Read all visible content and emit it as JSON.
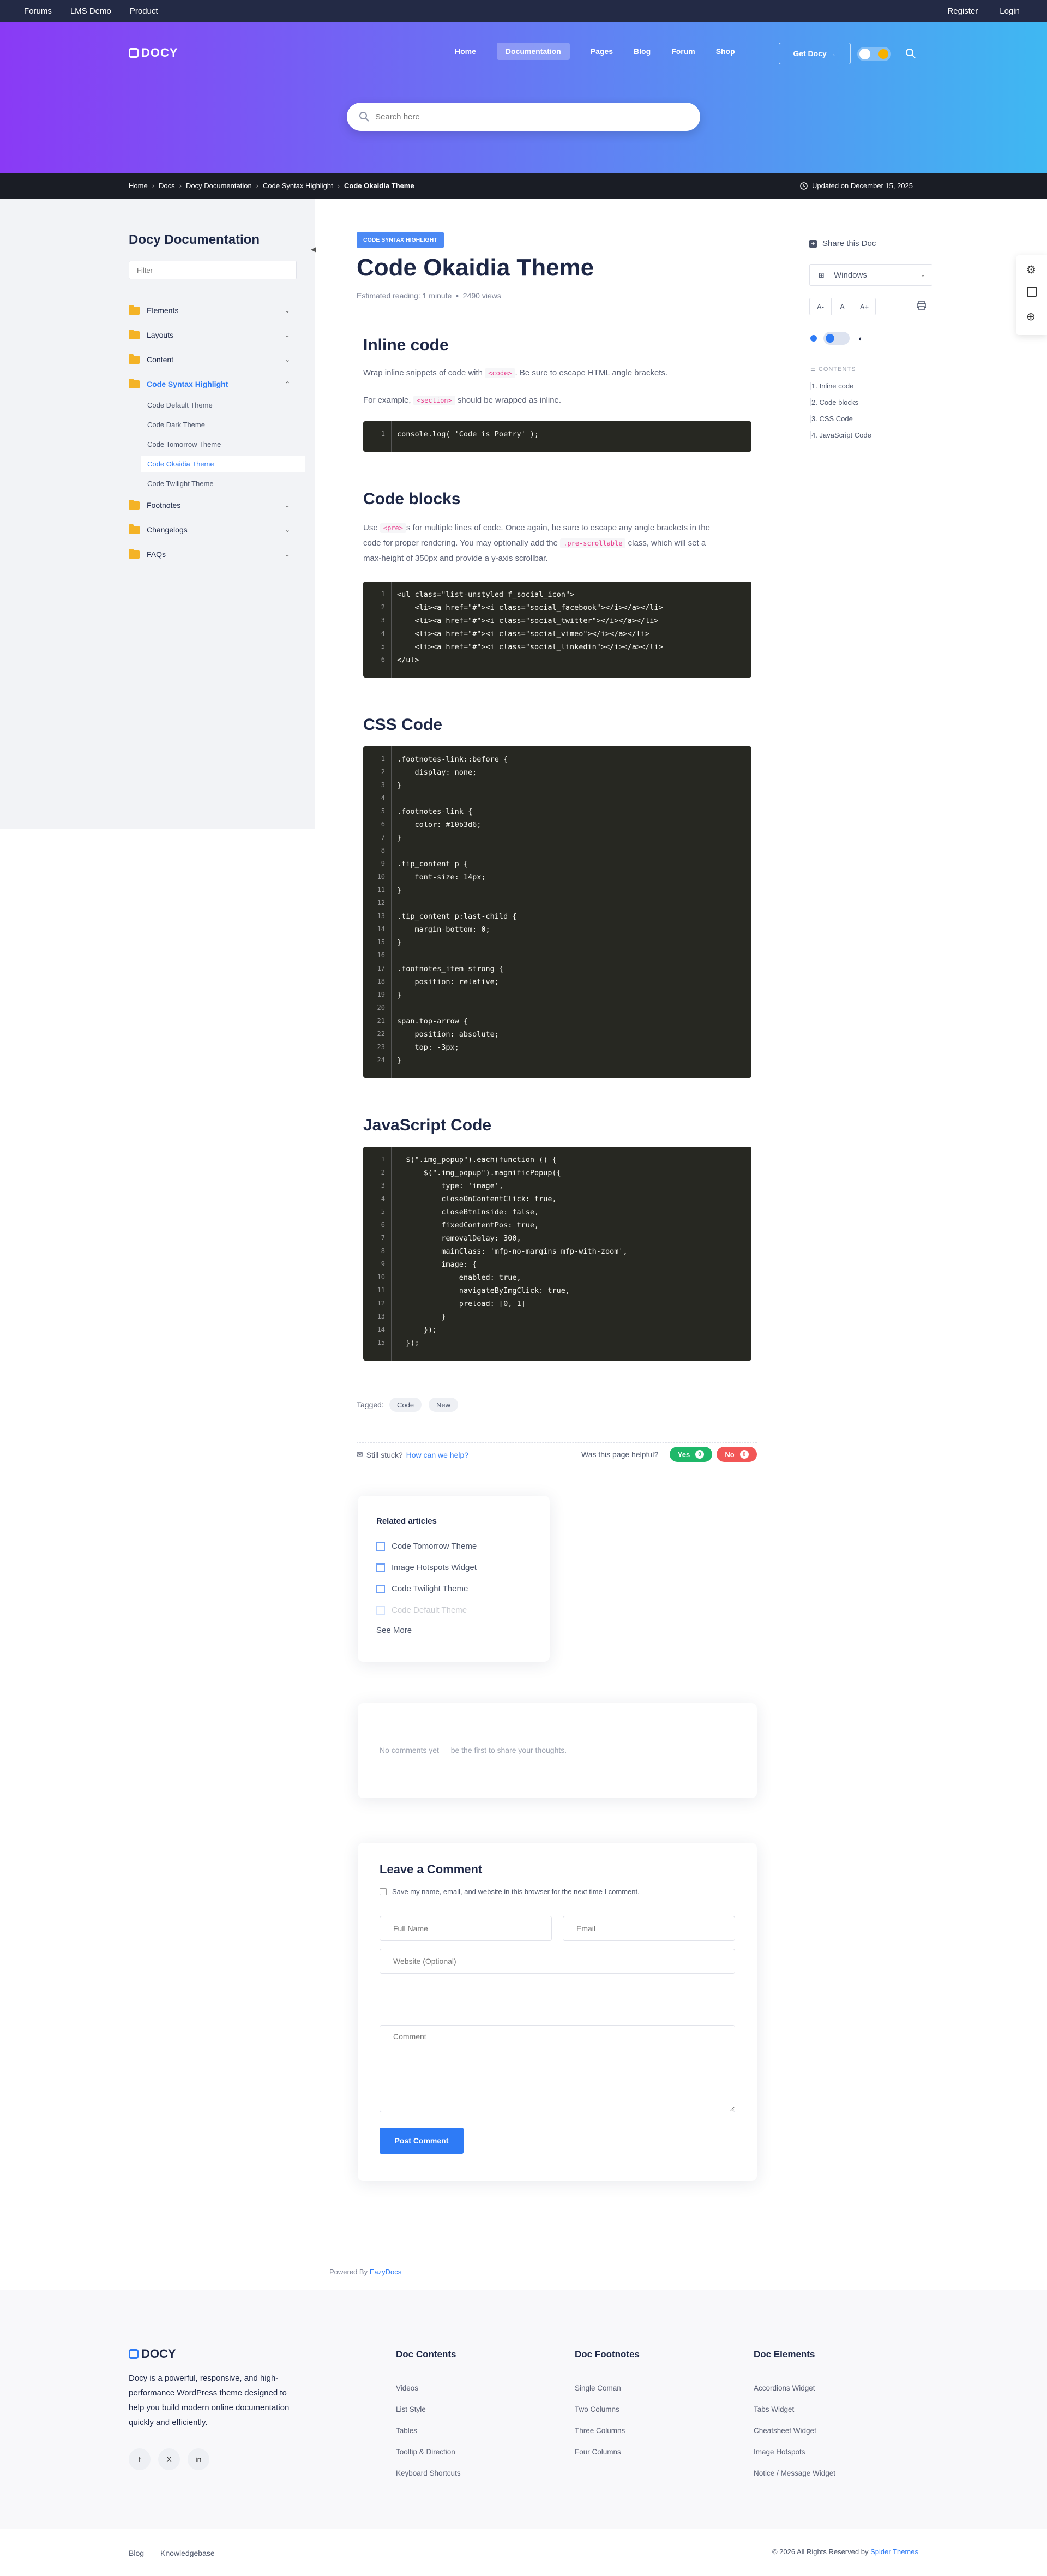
{
  "topbar": {
    "left": [
      "Forums",
      "LMS Demo",
      "Product"
    ],
    "right": [
      "Register",
      "Login"
    ]
  },
  "brand": "DOCY",
  "nav": {
    "items": [
      "Home",
      "Documentation",
      "Pages",
      "Blog",
      "Forum",
      "Shop"
    ],
    "active": "Documentation",
    "cta": "Get Docy →"
  },
  "search": {
    "placeholder": "Search here"
  },
  "breadcrumb": {
    "items": [
      "Home",
      "Docs",
      "Docy Documentation",
      "Code Syntax Highlight",
      "Code Okaidia Theme"
    ],
    "updated": "Updated on December 15, 2025"
  },
  "sidebar": {
    "title": "Docy Documentation",
    "filter_placeholder": "Filter",
    "items": [
      {
        "label": "Elements",
        "chevron": "⌄"
      },
      {
        "label": "Layouts",
        "chevron": "⌄"
      },
      {
        "label": "Content",
        "chevron": "⌄"
      },
      {
        "label": "Code Syntax Highlight",
        "chevron": "⌃"
      },
      {
        "label": "Footnotes",
        "chevron": "⌄"
      },
      {
        "label": "Changelogs",
        "chevron": "⌄"
      },
      {
        "label": "FAQs",
        "chevron": "⌄"
      }
    ],
    "subitems": [
      "Code Default Theme",
      "Code Dark Theme",
      "Code Tomorrow Theme",
      "Code Okaidia Theme",
      "Code Twilight Theme"
    ],
    "current": "Code Okaidia Theme"
  },
  "doc": {
    "badge": "CODE SYNTAX HIGHLIGHT",
    "title": "Code Okaidia Theme",
    "reading": "Estimated reading: 1 minute",
    "views": "2490 views"
  },
  "sections": {
    "inline": {
      "title": "Inline code",
      "p1_a": "Wrap inline snippets of code with",
      "p1_code": "<code>",
      "p1_b": ". Be sure to escape HTML angle brackets.",
      "p2_a": "For example,",
      "p2_code": "<section>",
      "p2_b": "should be wrapped as inline.",
      "code": [
        "console.log( 'Code is Poetry' );"
      ]
    },
    "blocks": {
      "title": "Code blocks",
      "p_a": "Use",
      "p_code1": "<pre>",
      "p_b": "s for multiple lines of code. Once again, be sure to escape any angle brackets in the",
      "p_c": "code for proper rendering. You may optionally add the",
      "p_code2": ".pre-scrollable",
      "p_d": "class, which will set a",
      "p_e": "max-height of 350px and provide a y-axis scrollbar.",
      "code": [
        "<ul class=\"list-unstyled f_social_icon\">",
        "    <li><a href=\"#\"><i class=\"social_facebook\"></i></a></li>",
        "    <li><a href=\"#\"><i class=\"social_twitter\"></i></a></li>",
        "    <li><a href=\"#\"><i class=\"social_vimeo\"></i></a></li>",
        "    <li><a href=\"#\"><i class=\"social_linkedin\"></i></a></li>",
        "</ul>"
      ]
    },
    "css": {
      "title": "CSS Code",
      "code": [
        ".footnotes-link::before {",
        "    display: none;",
        "}",
        "",
        ".footnotes-link {",
        "    color: #10b3d6;",
        "}",
        "",
        ".tip_content p {",
        "    font-size: 14px;",
        "}",
        "",
        ".tip_content p:last-child {",
        "    margin-bottom: 0;",
        "}",
        "",
        ".footnotes_item strong {",
        "    position: relative;",
        "}",
        "",
        "span.top-arrow {",
        "    position: absolute;",
        "    top: -3px;",
        "}"
      ]
    },
    "js": {
      "title": "JavaScript Code",
      "code": [
        "  $(\".img_popup\").each(function () {",
        "      $(\".img_popup\").magnificPopup({",
        "          type: 'image',",
        "          closeOnContentClick: true,",
        "          closeBtnInside: false,",
        "          fixedContentPos: true,",
        "          removalDelay: 300,",
        "          mainClass: 'mfp-no-margins mfp-with-zoom',",
        "          image: {",
        "              enabled: true,",
        "              navigateByImgClick: true,",
        "              preload: [0, 1]",
        "          }",
        "      });",
        "  });"
      ]
    }
  },
  "tags": {
    "label": "Tagged:",
    "items": [
      "Code",
      "New"
    ]
  },
  "help": {
    "stuck": "Still stuck?",
    "link": "How can we help?",
    "helpful": "Was this page helpful?",
    "yes": "Yes",
    "yes_count": "0",
    "no": "No",
    "no_count": "0"
  },
  "related": {
    "title": "Related articles",
    "items": [
      "Code Tomorrow Theme",
      "Image Hotspots Widget",
      "Code Twilight Theme",
      "Code Default Theme"
    ],
    "more": "See More"
  },
  "comments": {
    "empty": "No comments yet — be the first to share your thoughts."
  },
  "comment_form": {
    "title": "Leave a Comment",
    "checkbox": "Save my name, email, and website in this browser for the next time I comment.",
    "name_ph": "Full Name",
    "email_ph": "Email",
    "website_ph": "Website (Optional)",
    "comment_ph": "Comment",
    "submit": "Post Comment"
  },
  "powered": {
    "prefix": "Powered By",
    "link": "EazyDocs"
  },
  "right_panel": {
    "share": "Share this Doc",
    "os": "Windows",
    "font_buttons": [
      "A-",
      "A",
      "A+"
    ],
    "contents_label": "CONTENTS",
    "toc": [
      "1. Inline code",
      "2. Code blocks",
      "3. CSS Code",
      "4. JavaScript Code"
    ]
  },
  "footer": {
    "about": [
      "Docy is a powerful, responsive, and high-",
      "performance WordPress theme designed to",
      "help you build modern online documentation",
      "quickly and efficiently."
    ],
    "social": [
      "f",
      "X",
      "in"
    ],
    "cols": [
      {
        "title": "Doc Contents",
        "items": [
          "Videos",
          "List Style",
          "Tables",
          "Tooltip & Direction",
          "Keyboard Shortcuts"
        ]
      },
      {
        "title": "Doc Footnotes",
        "items": [
          "Single Coman",
          "Two Columns",
          "Three Columns",
          "Four Columns"
        ]
      },
      {
        "title": "Doc Elements",
        "items": [
          "Accordions Widget",
          "Tabs Widget",
          "Cheatsheet Widget",
          "Image Hotspots",
          "Notice / Message Widget"
        ]
      }
    ],
    "bottom_links": [
      "Blog",
      "Knowledgebase"
    ],
    "copyright": "© 2026 All Rights Reserved by",
    "copyright_link": "Spider Themes"
  },
  "colors": {
    "accent": "#2e7bf6",
    "code_bg": "#272822",
    "yes": "#1fb869",
    "no": "#f25656",
    "sidebar_bg": "#f2f3f6"
  }
}
